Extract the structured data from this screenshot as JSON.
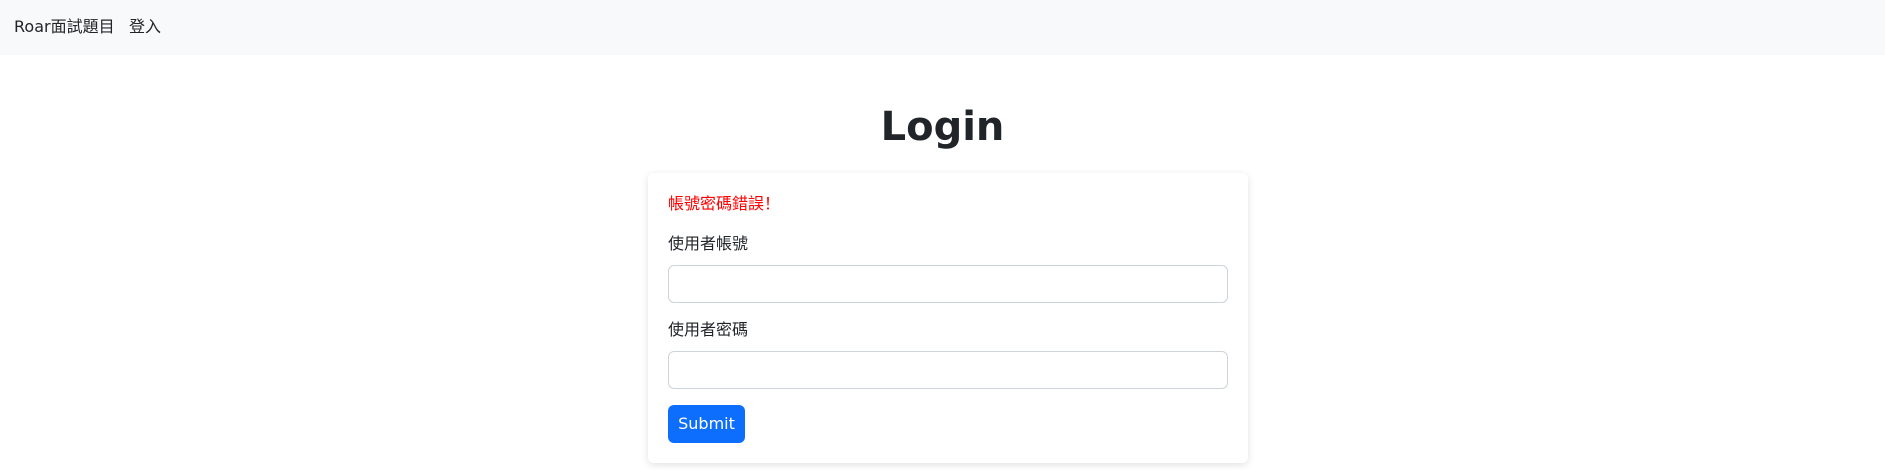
{
  "navbar": {
    "brand": "Roar面試題目",
    "login_link": "登入"
  },
  "page": {
    "title": "Login"
  },
  "form": {
    "error_message": "帳號密碼錯誤！",
    "username_label": "使用者帳號",
    "username_value": "",
    "password_label": "使用者密碼",
    "password_value": "",
    "submit_label": "Submit"
  },
  "colors": {
    "navbar_bg": "#f8f9fa",
    "error": "#ff0000",
    "primary": "#0d6efd"
  }
}
